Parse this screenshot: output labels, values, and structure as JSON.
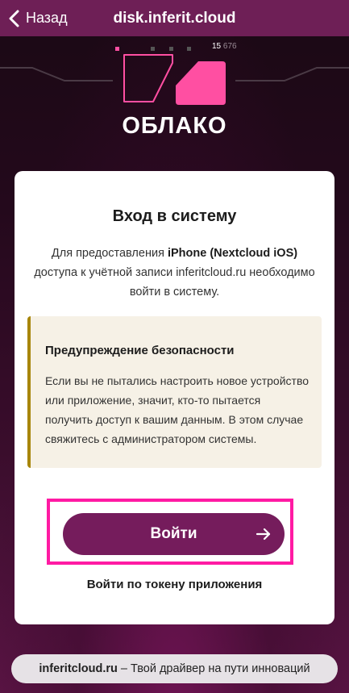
{
  "topbar": {
    "back_label": "Назад",
    "title": "disk.inferit.cloud"
  },
  "hero": {
    "counter_main": "15",
    "counter_dim": "676",
    "logo_text": "ОБЛАКО"
  },
  "card": {
    "title": "Вход в систему",
    "intro_before": "Для предоставления ",
    "intro_app": "iPhone (Nextcloud iOS)",
    "intro_after": " доступа к учётной записи inferitcloud.ru необходимо войти в систему.",
    "warning_title": "Предупреждение безопасности",
    "warning_text": "Если вы не пытались настроить новое устройство или приложение, значит, кто-то пытается получить доступ к вашим данным. В этом случае свяжитесь с администратором системы.",
    "login_label": "Войти",
    "token_link": "Войти по токену приложения"
  },
  "footer": {
    "brand": "inferitcloud.ru",
    "tagline": " – Твой драйвер на пути инноваций"
  },
  "colors": {
    "topbar": "#6e1f56",
    "accent_pink": "#ff4fa2",
    "button": "#751c5c",
    "highlight": "#ff1aa3",
    "warning_bar": "#a7860a"
  }
}
